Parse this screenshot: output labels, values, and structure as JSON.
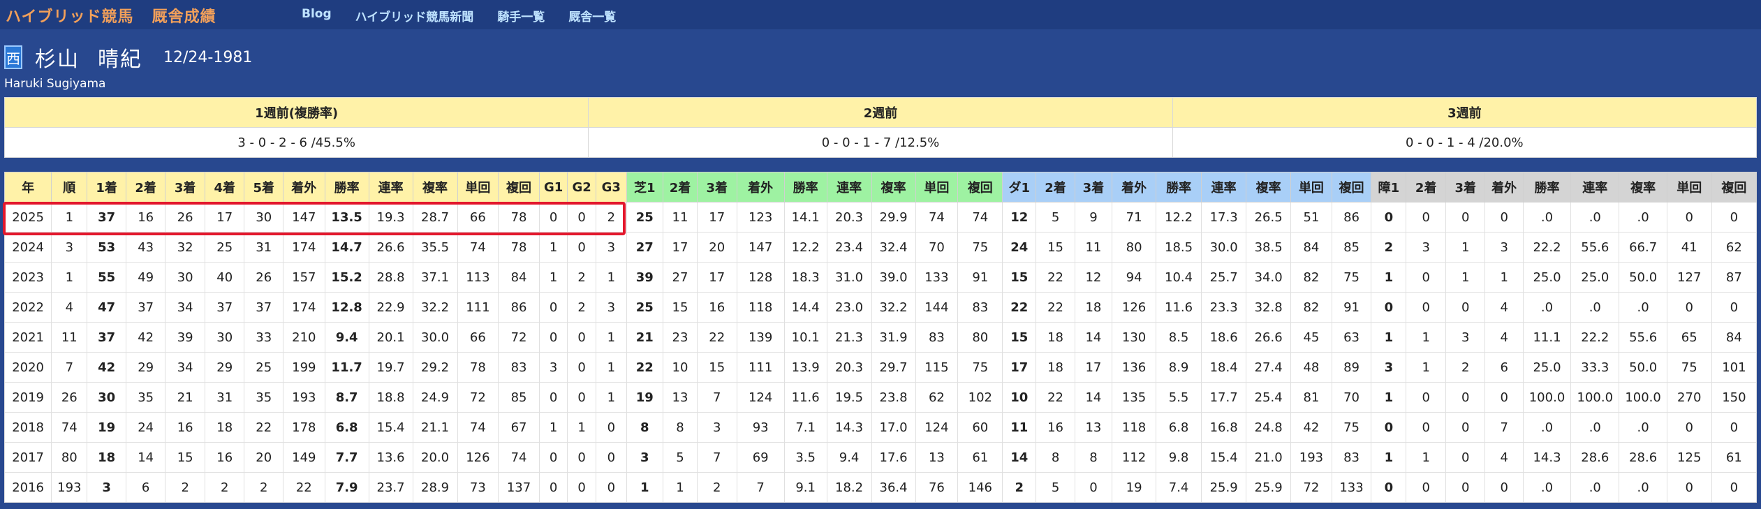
{
  "nav": {
    "brand_main": "ハイブリッド競馬",
    "brand_sub": "厩舎成績",
    "links": [
      "Blog",
      "ハイブリッド競馬新聞",
      "騎手一覧",
      "厩舎一覧"
    ]
  },
  "jockey": {
    "region_badge": "西",
    "surname": "杉山",
    "given_name": "晴紀",
    "birth_date": "12/24-1981",
    "romaji": "Haruki Sugiyama"
  },
  "recent_weeks": {
    "headers": [
      "1週前(複勝率)",
      "2週前",
      "3週前"
    ],
    "values": [
      "3 - 0 - 2 - 6 /45.5%",
      "0 - 0 - 1 - 7 /12.5%",
      "0 - 0 - 1 - 4 /20.0%"
    ]
  },
  "colors": {
    "all_header": "#fff2a8",
    "turf_header": "#9ef2a2",
    "dirt_header": "#a9cff7",
    "jump_header": "#d4d4d4",
    "highlight_border": "#e3172c"
  },
  "stats_table": {
    "headers": [
      "年",
      "順",
      "1着",
      "2着",
      "3着",
      "4着",
      "5着",
      "着外",
      "勝率",
      "連率",
      "複率",
      "単回",
      "複回",
      "G1",
      "G2",
      "G3",
      "芝1",
      "2着",
      "3着",
      "着外",
      "勝率",
      "連率",
      "複率",
      "単回",
      "複回",
      "ダ1",
      "2着",
      "3着",
      "着外",
      "勝率",
      "連率",
      "複率",
      "単回",
      "複回",
      "障1",
      "2着",
      "3着",
      "着外",
      "勝率",
      "連率",
      "複率",
      "単回",
      "複回"
    ],
    "highlighted_year": "2025",
    "rows": [
      [
        "2025",
        "1",
        "37",
        "16",
        "26",
        "17",
        "30",
        "147",
        "13.5",
        "19.3",
        "28.7",
        "66",
        "78",
        "0",
        "0",
        "2",
        "25",
        "11",
        "17",
        "123",
        "14.1",
        "20.3",
        "29.9",
        "74",
        "74",
        "12",
        "5",
        "9",
        "71",
        "12.2",
        "17.3",
        "26.5",
        "51",
        "86",
        "0",
        "0",
        "0",
        "0",
        ".0",
        ".0",
        ".0",
        "0",
        "0"
      ],
      [
        "2024",
        "3",
        "53",
        "43",
        "32",
        "25",
        "31",
        "174",
        "14.7",
        "26.6",
        "35.5",
        "74",
        "78",
        "1",
        "0",
        "3",
        "27",
        "17",
        "20",
        "147",
        "12.2",
        "23.4",
        "32.4",
        "70",
        "75",
        "24",
        "15",
        "11",
        "80",
        "18.5",
        "30.0",
        "38.5",
        "84",
        "85",
        "2",
        "3",
        "1",
        "3",
        "22.2",
        "55.6",
        "66.7",
        "41",
        "62"
      ],
      [
        "2023",
        "1",
        "55",
        "49",
        "30",
        "40",
        "26",
        "157",
        "15.2",
        "28.8",
        "37.1",
        "113",
        "84",
        "1",
        "2",
        "1",
        "39",
        "27",
        "17",
        "128",
        "18.3",
        "31.0",
        "39.0",
        "133",
        "91",
        "15",
        "22",
        "12",
        "94",
        "10.4",
        "25.7",
        "34.0",
        "82",
        "75",
        "1",
        "0",
        "1",
        "1",
        "25.0",
        "25.0",
        "50.0",
        "127",
        "87"
      ],
      [
        "2022",
        "4",
        "47",
        "37",
        "34",
        "37",
        "37",
        "174",
        "12.8",
        "22.9",
        "32.2",
        "111",
        "86",
        "0",
        "2",
        "3",
        "25",
        "15",
        "16",
        "118",
        "14.4",
        "23.0",
        "32.2",
        "144",
        "83",
        "22",
        "22",
        "18",
        "126",
        "11.6",
        "23.3",
        "32.8",
        "82",
        "91",
        "0",
        "0",
        "0",
        "4",
        ".0",
        ".0",
        ".0",
        "0",
        "0"
      ],
      [
        "2021",
        "11",
        "37",
        "42",
        "39",
        "30",
        "33",
        "210",
        "9.4",
        "20.1",
        "30.0",
        "66",
        "72",
        "0",
        "0",
        "1",
        "21",
        "23",
        "22",
        "139",
        "10.1",
        "21.3",
        "31.9",
        "83",
        "80",
        "15",
        "18",
        "14",
        "130",
        "8.5",
        "18.6",
        "26.6",
        "45",
        "63",
        "1",
        "1",
        "3",
        "4",
        "11.1",
        "22.2",
        "55.6",
        "65",
        "84"
      ],
      [
        "2020",
        "7",
        "42",
        "29",
        "34",
        "29",
        "25",
        "199",
        "11.7",
        "19.7",
        "29.2",
        "78",
        "83",
        "3",
        "0",
        "1",
        "22",
        "10",
        "15",
        "111",
        "13.9",
        "20.3",
        "29.7",
        "115",
        "75",
        "17",
        "18",
        "17",
        "136",
        "8.9",
        "18.4",
        "27.4",
        "48",
        "89",
        "3",
        "1",
        "2",
        "6",
        "25.0",
        "33.3",
        "50.0",
        "75",
        "101"
      ],
      [
        "2019",
        "26",
        "30",
        "35",
        "21",
        "31",
        "35",
        "193",
        "8.7",
        "18.8",
        "24.9",
        "72",
        "85",
        "0",
        "0",
        "1",
        "19",
        "13",
        "7",
        "124",
        "11.6",
        "19.5",
        "23.8",
        "62",
        "102",
        "10",
        "22",
        "14",
        "135",
        "5.5",
        "17.7",
        "25.4",
        "81",
        "70",
        "1",
        "0",
        "0",
        "0",
        "100.0",
        "100.0",
        "100.0",
        "270",
        "150"
      ],
      [
        "2018",
        "74",
        "19",
        "24",
        "16",
        "18",
        "22",
        "178",
        "6.8",
        "15.4",
        "21.1",
        "74",
        "67",
        "1",
        "1",
        "0",
        "8",
        "8",
        "3",
        "93",
        "7.1",
        "14.3",
        "17.0",
        "124",
        "60",
        "11",
        "16",
        "13",
        "118",
        "6.8",
        "16.8",
        "24.8",
        "42",
        "75",
        "0",
        "0",
        "0",
        "7",
        ".0",
        ".0",
        ".0",
        "0",
        "0"
      ],
      [
        "2017",
        "80",
        "18",
        "14",
        "15",
        "16",
        "20",
        "149",
        "7.7",
        "13.6",
        "20.0",
        "126",
        "74",
        "0",
        "0",
        "0",
        "3",
        "5",
        "7",
        "69",
        "3.5",
        "9.4",
        "17.6",
        "13",
        "61",
        "14",
        "8",
        "8",
        "112",
        "9.8",
        "15.4",
        "21.0",
        "193",
        "83",
        "1",
        "1",
        "0",
        "4",
        "14.3",
        "28.6",
        "28.6",
        "125",
        "61"
      ],
      [
        "2016",
        "193",
        "3",
        "6",
        "2",
        "2",
        "2",
        "22",
        "7.9",
        "23.7",
        "28.9",
        "73",
        "137",
        "0",
        "0",
        "0",
        "1",
        "1",
        "2",
        "7",
        "9.1",
        "18.2",
        "36.4",
        "76",
        "146",
        "2",
        "5",
        "0",
        "19",
        "7.4",
        "25.9",
        "25.9",
        "72",
        "133",
        "0",
        "0",
        "0",
        "0",
        ".0",
        ".0",
        ".0",
        "0",
        "0"
      ]
    ]
  }
}
